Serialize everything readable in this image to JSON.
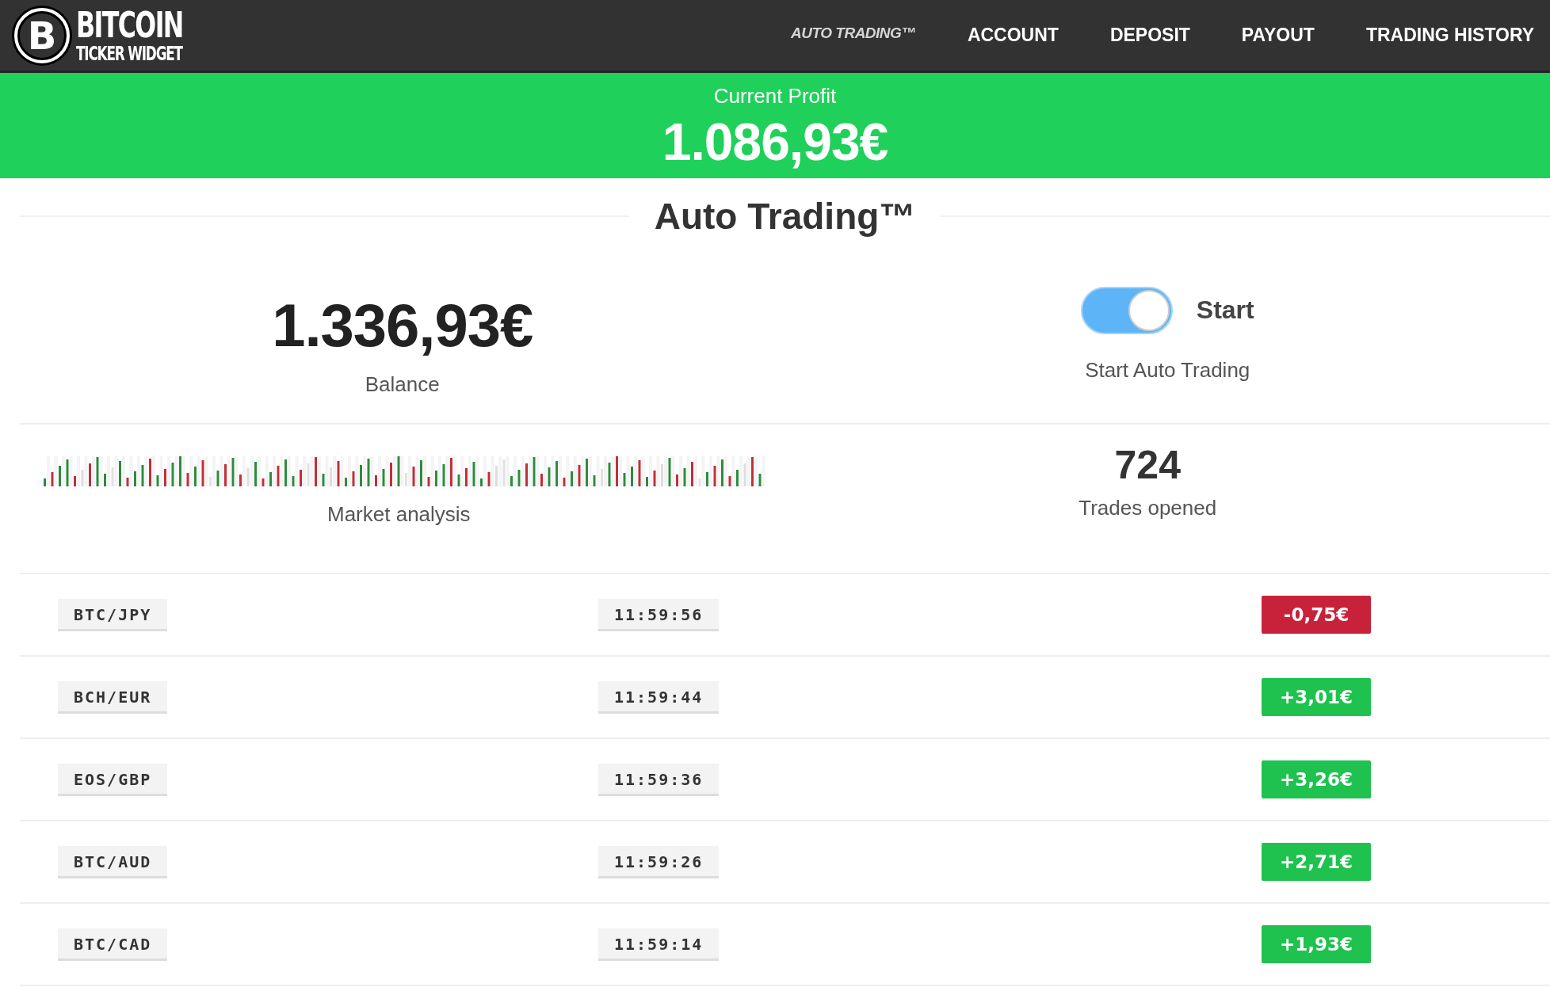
{
  "header": {
    "logo": {
      "letter": "B",
      "line1": "BITCOIN",
      "line2": "TICKER WIDGET"
    },
    "nav": [
      {
        "label": "AUTO TRADING™",
        "selected": true
      },
      {
        "label": "ACCOUNT",
        "selected": false
      },
      {
        "label": "DEPOSIT",
        "selected": false
      },
      {
        "label": "PAYOUT",
        "selected": false
      },
      {
        "label": "TRADING HISTORY",
        "selected": false
      }
    ]
  },
  "profit_banner": {
    "label": "Current Profit",
    "value": "1.086,93€"
  },
  "section_title": "Auto Trading™",
  "balance": {
    "value": "1.336,93€",
    "label": "Balance"
  },
  "auto_trading": {
    "toggle_label": "Start",
    "on": true,
    "label": "Start Auto Trading"
  },
  "market": {
    "label": "Market analysis"
  },
  "trades_opened": {
    "value": "724",
    "label": "Trades opened"
  },
  "trades": [
    {
      "pair": "BTC/JPY",
      "time": "11:59:56",
      "profit": "-0,75€",
      "kind": "loss"
    },
    {
      "pair": "BCH/EUR",
      "time": "11:59:44",
      "profit": "+3,01€",
      "kind": "gain"
    },
    {
      "pair": "EOS/GBP",
      "time": "11:59:36",
      "profit": "+3,26€",
      "kind": "gain"
    },
    {
      "pair": "BTC/AUD",
      "time": "11:59:26",
      "profit": "+2,71€",
      "kind": "gain"
    },
    {
      "pair": "BTC/CAD",
      "time": "11:59:14",
      "profit": "+1,93€",
      "kind": "gain"
    }
  ]
}
